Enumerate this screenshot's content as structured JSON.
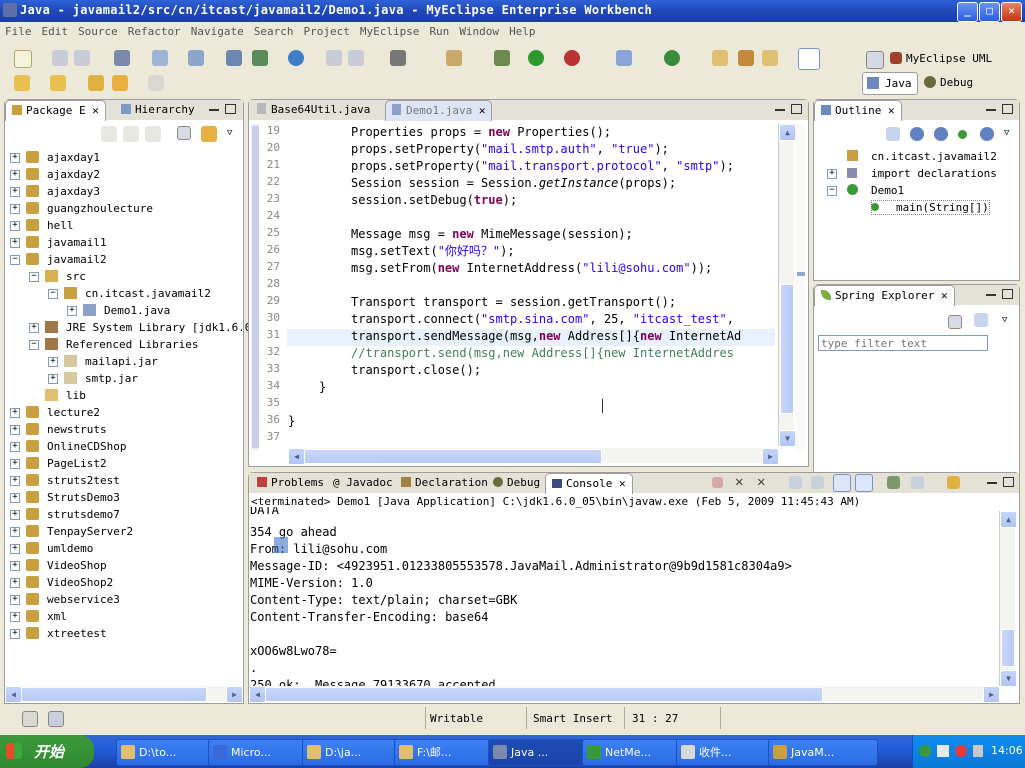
{
  "window": {
    "title": "Java - javamail2/src/cn/itcast/javamail2/Demo1.java - MyEclipse Enterprise Workbench",
    "min": "_",
    "max": "□",
    "close": "✕"
  },
  "menu": [
    "File",
    "Edit",
    "Source",
    "Refactor",
    "Navigate",
    "Search",
    "Project",
    "MyEclipse",
    "Run",
    "Window",
    "Help"
  ],
  "perspectives": {
    "uml": "MyEclipse UML",
    "java": "Java",
    "debug": "Debug"
  },
  "package_explorer": {
    "tabs": [
      "Package E",
      "Hierarchy"
    ],
    "items": [
      {
        "label": "ajaxday1",
        "level": 0,
        "type": "project",
        "exp": "+"
      },
      {
        "label": "ajaxday2",
        "level": 0,
        "type": "project",
        "exp": "+"
      },
      {
        "label": "ajaxday3",
        "level": 0,
        "type": "project",
        "exp": "+"
      },
      {
        "label": "guangzhoulecture",
        "level": 0,
        "type": "project",
        "exp": "+"
      },
      {
        "label": "hell",
        "level": 0,
        "type": "project",
        "exp": "+"
      },
      {
        "label": "javamail1",
        "level": 0,
        "type": "project",
        "exp": "+"
      },
      {
        "label": "javamail2",
        "level": 0,
        "type": "project",
        "exp": "-"
      },
      {
        "label": "src",
        "level": 1,
        "type": "srcfolder",
        "exp": "-"
      },
      {
        "label": "cn.itcast.javamail2",
        "level": 2,
        "type": "package",
        "exp": "-"
      },
      {
        "label": "Demo1.java",
        "level": 3,
        "type": "java",
        "exp": "+"
      },
      {
        "label": "JRE System Library [jdk1.6.0_",
        "level": 1,
        "type": "library",
        "exp": "+"
      },
      {
        "label": "Referenced Libraries",
        "level": 1,
        "type": "library",
        "exp": "-"
      },
      {
        "label": "mailapi.jar",
        "level": 2,
        "type": "jar",
        "exp": "+"
      },
      {
        "label": "smtp.jar",
        "level": 2,
        "type": "jar",
        "exp": "+"
      },
      {
        "label": "lib",
        "level": 1,
        "type": "folder",
        "exp": ""
      },
      {
        "label": "lecture2",
        "level": 0,
        "type": "project",
        "exp": "+"
      },
      {
        "label": "newstruts",
        "level": 0,
        "type": "project",
        "exp": "+"
      },
      {
        "label": "OnlineCDShop",
        "level": 0,
        "type": "project",
        "exp": "+"
      },
      {
        "label": "PageList2",
        "level": 0,
        "type": "project",
        "exp": "+"
      },
      {
        "label": "struts2test",
        "level": 0,
        "type": "project",
        "exp": "+"
      },
      {
        "label": "StrutsDemo3",
        "level": 0,
        "type": "project",
        "exp": "+"
      },
      {
        "label": "strutsdemo7",
        "level": 0,
        "type": "project",
        "exp": "+"
      },
      {
        "label": "TenpayServer2",
        "level": 0,
        "type": "project",
        "exp": "+"
      },
      {
        "label": "umldemo",
        "level": 0,
        "type": "project",
        "exp": "+"
      },
      {
        "label": "VideoShop",
        "level": 0,
        "type": "project",
        "exp": "+"
      },
      {
        "label": "VideoShop2",
        "level": 0,
        "type": "project",
        "exp": "+"
      },
      {
        "label": "webservice3",
        "level": 0,
        "type": "project",
        "exp": "+"
      },
      {
        "label": "xml",
        "level": 0,
        "type": "project",
        "exp": "+"
      },
      {
        "label": "xtreetest",
        "level": 0,
        "type": "project",
        "exp": "+"
      }
    ]
  },
  "editor": {
    "tabs": [
      "Base64Util.java",
      "Demo1.java"
    ],
    "lines": [
      {
        "n": "19",
        "html": "Properties props = <span class='kw'>new</span> Properties();"
      },
      {
        "n": "20",
        "html": "props.setProperty(<span class='str'>\"mail.smtp.auth\"</span>, <span class='str'>\"true\"</span>);"
      },
      {
        "n": "21",
        "html": "props.setProperty(<span class='str'>\"mail.transport.protocol\"</span>, <span class='str'>\"smtp\"</span>);"
      },
      {
        "n": "22",
        "html": "Session session = Session.<span class='it'>getInstance</span>(props);"
      },
      {
        "n": "23",
        "html": "session.setDebug(<span class='kw'>true</span>);"
      },
      {
        "n": "24",
        "html": ""
      },
      {
        "n": "25",
        "html": "Message msg = <span class='kw'>new</span> MimeMessage(session);"
      },
      {
        "n": "26",
        "html": "msg.setText(<span class='str'>\"你好吗？\"</span>);"
      },
      {
        "n": "27",
        "html": "msg.setFrom(<span class='kw'>new</span> InternetAddress(<span class='str'>\"lili@sohu.com\"</span>));"
      },
      {
        "n": "28",
        "html": ""
      },
      {
        "n": "29",
        "html": "Transport transport = session.getTransport();"
      },
      {
        "n": "30",
        "html": "transport.connect(<span class='str'>\"smtp.sina.com\"</span>, 25, <span class='str'>\"itcast_test\"</span>,"
      },
      {
        "n": "31",
        "html": "transport.sendMessage(msg,<span class='kw'>new</span> Address[]{<span class='kw'>new</span> InternetAd"
      },
      {
        "n": "32",
        "html": "<span class='cmt'>//transport.send(msg,new Address[]{new InternetAddres</span>"
      },
      {
        "n": "33",
        "html": "transport.close();"
      },
      {
        "n": "34",
        "html": "}"
      },
      {
        "n": "35",
        "html": ""
      },
      {
        "n": "36",
        "html": "}"
      },
      {
        "n": "37",
        "html": ""
      }
    ]
  },
  "outline": {
    "title": "Outline",
    "items": [
      "cn.itcast.javamail2",
      "import declarations",
      "Demo1",
      "main(String[])"
    ]
  },
  "spring_explorer": {
    "title": "Spring Explorer",
    "filter_placeholder": "type filter text"
  },
  "bottom_tabs": [
    "Problems",
    "Javadoc",
    "Declaration",
    "Debug",
    "Console"
  ],
  "console": {
    "header": "<terminated> Demo1 [Java Application] C:\\jdk1.6.0_05\\bin\\javaw.exe (Feb 5, 2009 11:45:43 AM)",
    "lines": [
      "DATA",
      "354 go ahead",
      "From: lili@sohu.com",
      "Message-ID: <4923951.01233805553578.JavaMail.Administrator@9b9d1581c8304a9>",
      "MIME-Version: 1.0",
      "Content-Type: text/plain; charset=GBK",
      "Content-Transfer-Encoding: base64",
      "",
      "xOO6w8Lwo78=",
      ".",
      "250 ok:  Message 79133670 accepted"
    ]
  },
  "status": {
    "writable": "Writable",
    "insert": "Smart Insert",
    "position": "31 : 27"
  },
  "taskbar": {
    "start": "开始",
    "buttons": [
      "D:\\to...",
      "Micro...",
      "D:\\ja...",
      "F:\\邮...",
      "Java ...",
      "NetMe...",
      "收件...",
      "JavaM..."
    ],
    "clock": "14:06"
  },
  "colors": {
    "keyword": "#7f0055",
    "string": "#2a00ff",
    "comment": "#3f7f5f",
    "title_bar": "#1f48b8"
  }
}
